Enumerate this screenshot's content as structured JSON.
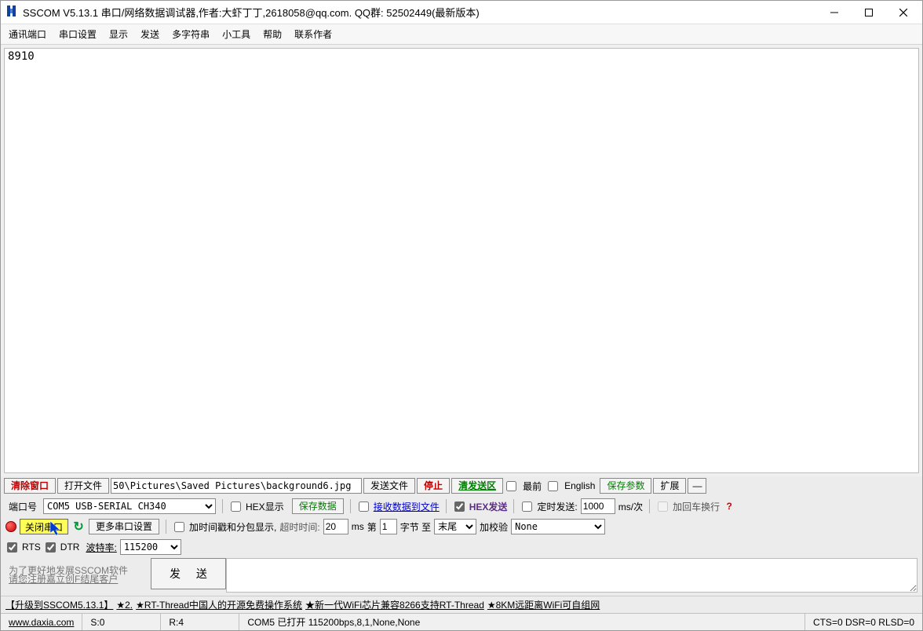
{
  "window": {
    "title": "SSCOM V5.13.1 串口/网络数据调试器,作者:大虾丁丁,2618058@qq.com. QQ群:  52502449(最新版本)"
  },
  "menu": [
    "通讯端口",
    "串口设置",
    "显示",
    "发送",
    "多字符串",
    "小工具",
    "帮助",
    "联系作者"
  ],
  "receive_text": "8910",
  "toolbar1": {
    "clear": "清除窗口",
    "open_file": "打开文件",
    "file_path": "50\\Pictures\\Saved Pictures\\background6.jpg",
    "send_file": "发送文件",
    "stop": "停止",
    "clear_send": "清发送区",
    "top_most": "最前",
    "english": "English",
    "save_params": "保存参数",
    "extend": "扩展",
    "minus": "—"
  },
  "row_a": {
    "port_label": "端口号",
    "port_value": "COM5 USB-SERIAL CH340",
    "hex_display": "HEX显示",
    "save_data": "保存数据",
    "recv_to_file": "接收数据到文件",
    "hex_send": "HEX发送",
    "timed_send": "定时发送:",
    "period_value": "1000",
    "period_unit": "ms/次",
    "add_crlf": "加回车换行",
    "help": "?"
  },
  "row_b": {
    "open_port": "关闭串口",
    "more_settings": "更多串口设置",
    "timestamp_pkt": "加时间戳和分包显示,",
    "timeout_label": "超时时间:",
    "timeout_value": "20",
    "timeout_unit": "ms",
    "first_label": "第",
    "first_value": "1",
    "byte_to": "字节 至",
    "tail": "末尾",
    "add_check": "加校验",
    "check_value": "None"
  },
  "row_c": {
    "rts": "RTS",
    "dtr": "DTR",
    "baud_label": "波特率:",
    "baud_value": "115200"
  },
  "footer": {
    "promo1": "为了更好地发展SSCOM软件",
    "promo2": "请您注册嘉立创F结尾客户",
    "send_btn": "发  送"
  },
  "ad_bar": {
    "upgrade": "【升级到SSCOM5.13.1】",
    "star2": "★2.",
    "rtthread": "★RT-Thread中国人的开源免费操作系统",
    "wifi": "★新一代WiFi芯片兼容8266支持RT-Thread",
    "km8": "★8KM远距离WiFi可自组网"
  },
  "status": {
    "site": "www.daxia.com",
    "s": "S:0",
    "r": "R:4",
    "port_status": "COM5 已打开  115200bps,8,1,None,None",
    "signals": "CTS=0 DSR=0 RLSD=0"
  }
}
